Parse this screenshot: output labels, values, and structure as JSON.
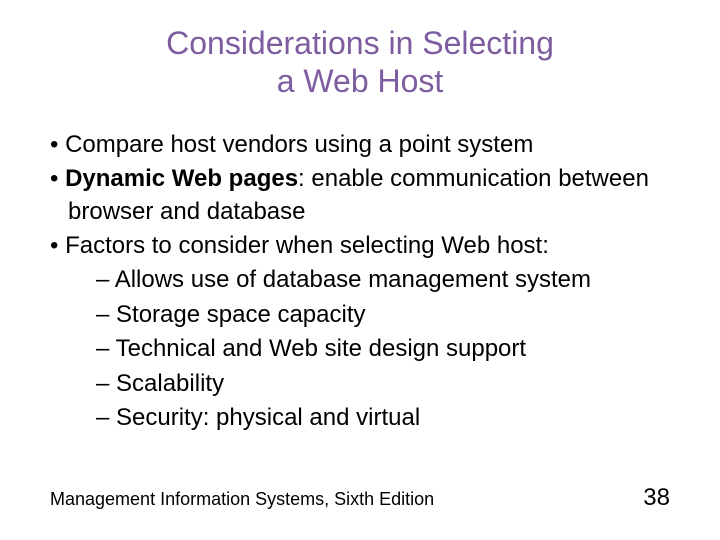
{
  "title_line1": "Considerations in Selecting",
  "title_line2": "a Web Host",
  "bullets": {
    "b1": "Compare host vendors using a point system",
    "b2_bold": "Dynamic Web pages",
    "b2_rest": ": enable communication between browser and database",
    "b3": "Factors to consider when selecting Web host:",
    "s1": "Allows use of database management system",
    "s2": "Storage space capacity",
    "s3": "Technical and Web site design support",
    "s4": "Scalability",
    "s5": "Security: physical and virtual"
  },
  "footer_text": "Management Information Systems, Sixth Edition",
  "page_number": "38"
}
